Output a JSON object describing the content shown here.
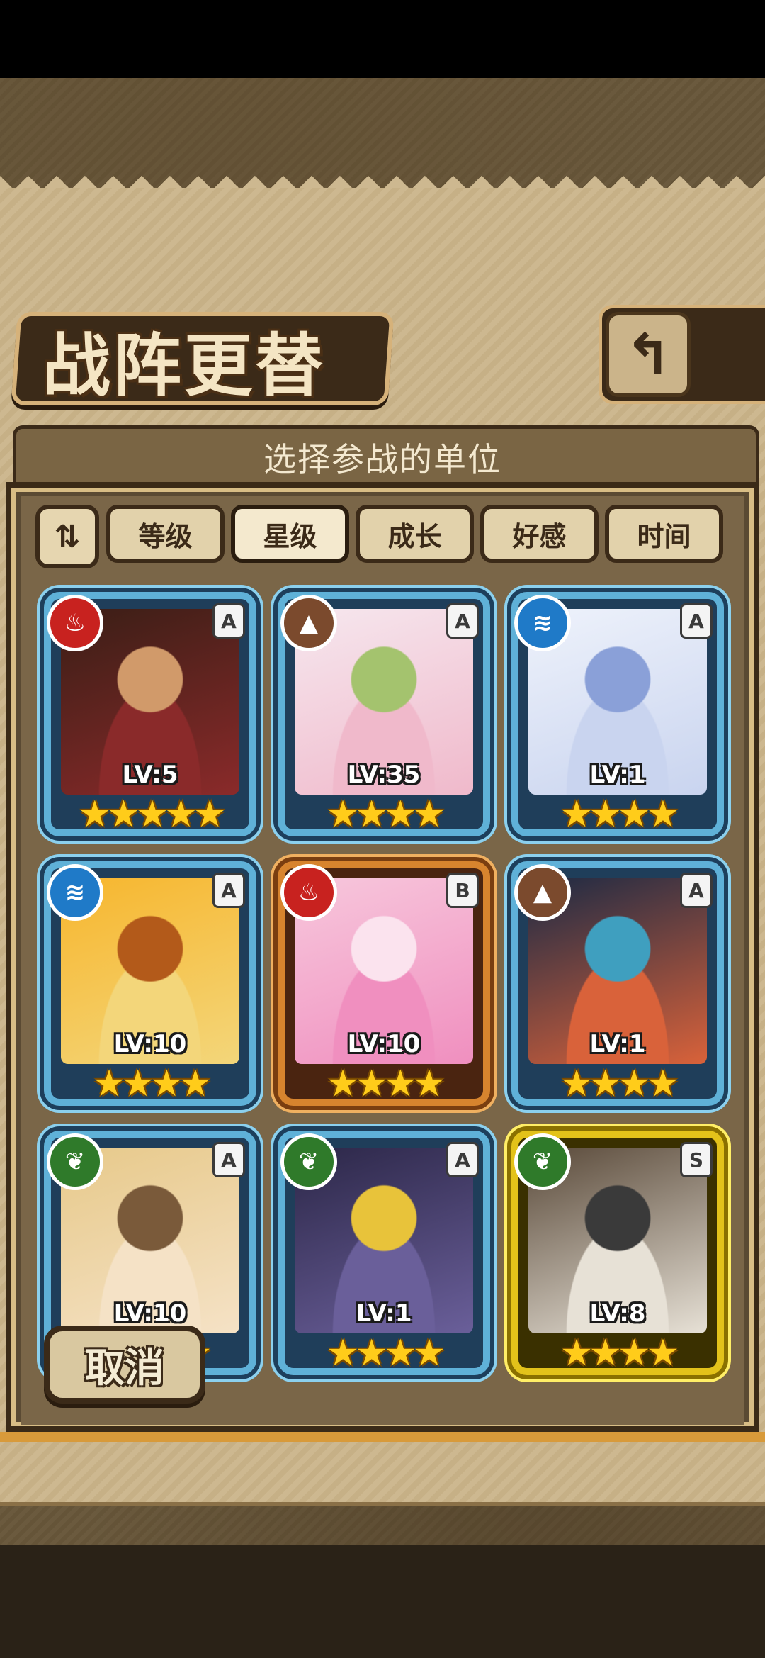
{
  "header": {
    "title": "战阵更替",
    "back_icon": "↰"
  },
  "subtitle": "选择参战的单位",
  "sort_toggle_icon": "⇅",
  "tabs": [
    {
      "label": "等级",
      "active": false
    },
    {
      "label": "星级",
      "active": true
    },
    {
      "label": "成长",
      "active": false
    },
    {
      "label": "好感",
      "active": false
    },
    {
      "label": "时间",
      "active": false
    }
  ],
  "units": [
    {
      "element": "fire",
      "element_icon": "fire-icon",
      "grade": "A",
      "level": "LV:5",
      "stars": "★★★★★",
      "frame": "blue",
      "colors": [
        "#3a1e16",
        "#8a2a2a",
        "#d19a6a"
      ]
    },
    {
      "element": "earth",
      "element_icon": "mountain-icon",
      "grade": "A",
      "level": "LV:35",
      "stars": "★★★★",
      "frame": "blue",
      "colors": [
        "#f6e7ee",
        "#f0b9cb",
        "#a4c36e"
      ]
    },
    {
      "element": "water",
      "element_icon": "wave-icon",
      "grade": "A",
      "level": "LV:1",
      "stars": "★★★★",
      "frame": "blue",
      "colors": [
        "#eef2fb",
        "#c9d4ef",
        "#8aa0d8"
      ]
    },
    {
      "element": "water",
      "element_icon": "wave-icon",
      "grade": "A",
      "level": "LV:10",
      "stars": "★★★★",
      "frame": "blue",
      "colors": [
        "#f7b62e",
        "#f3d67a",
        "#b35a1a"
      ]
    },
    {
      "element": "fire",
      "element_icon": "fire-icon",
      "grade": "B",
      "level": "LV:10",
      "stars": "★★★★",
      "frame": "bronze",
      "colors": [
        "#f7c7dc",
        "#f08fbf",
        "#fbe3ee"
      ]
    },
    {
      "element": "earth",
      "element_icon": "mountain-icon",
      "grade": "A",
      "level": "LV:1",
      "stars": "★★★★",
      "frame": "blue",
      "colors": [
        "#1d2a44",
        "#d9623a",
        "#3f9fbf"
      ]
    },
    {
      "element": "wood",
      "element_icon": "leaf-icon",
      "grade": "A",
      "level": "LV:10",
      "stars": "★★★★",
      "frame": "blue",
      "colors": [
        "#e7c98a",
        "#f5e2c6",
        "#7a5a3a"
      ]
    },
    {
      "element": "wood",
      "element_icon": "leaf-icon",
      "grade": "A",
      "level": "LV:1",
      "stars": "★★★★",
      "frame": "blue",
      "colors": [
        "#2c2748",
        "#6a5f9a",
        "#e8c33a"
      ]
    },
    {
      "element": "wood",
      "element_icon": "leaf-icon",
      "grade": "S",
      "level": "LV:8",
      "stars": "★★★★",
      "frame": "gold",
      "colors": [
        "#5a4a3a",
        "#e7e1d6",
        "#3a3a3a"
      ]
    }
  ],
  "cancel_label": "取消"
}
